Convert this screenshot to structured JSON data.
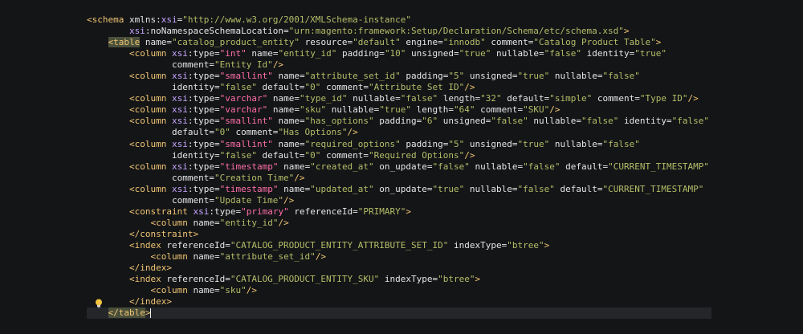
{
  "editor": {
    "lines": [
      {
        "indent": 0,
        "tokens": [
          [
            "tag",
            "<schema "
          ],
          [
            "attr",
            "xmlns:"
          ],
          [
            "ns",
            "xsi"
          ],
          [
            "punct",
            "="
          ],
          [
            "str",
            "\"http://www.w3.org/2001/XMLSchema-instance\""
          ]
        ]
      },
      {
        "indent": 8,
        "tokens": [
          [
            "ns",
            "xsi"
          ],
          [
            "attr",
            ":noNamespaceSchemaLocation="
          ],
          [
            "str",
            "\"urn:magento:framework:Setup/Declaration/Schema/etc/schema.xsd\""
          ],
          [
            "tag",
            ">"
          ]
        ]
      },
      {
        "indent": 4,
        "tokens": [
          [
            "taghl",
            "<table"
          ],
          [
            "attr",
            " name="
          ],
          [
            "str",
            "\"catalog_product_entity\""
          ],
          [
            "attr",
            " resource="
          ],
          [
            "str",
            "\"default\""
          ],
          [
            "attr",
            " engine="
          ],
          [
            "str",
            "\"innodb\""
          ],
          [
            "attr",
            " comment="
          ],
          [
            "str",
            "\"Catalog Product Table\""
          ],
          [
            "tag",
            ">"
          ]
        ]
      },
      {
        "indent": 8,
        "tokens": [
          [
            "tag",
            "<column "
          ],
          [
            "ns",
            "xsi"
          ],
          [
            "attr",
            ":type="
          ],
          [
            "type",
            "\"int\""
          ],
          [
            "attr",
            " name="
          ],
          [
            "str",
            "\"entity_id\""
          ],
          [
            "attr",
            " padding="
          ],
          [
            "str",
            "\"10\""
          ],
          [
            "attr",
            " unsigned="
          ],
          [
            "str",
            "\"true\""
          ],
          [
            "attr",
            " nullable="
          ],
          [
            "str",
            "\"false\""
          ],
          [
            "attr",
            " identity="
          ],
          [
            "str",
            "\"true\""
          ]
        ]
      },
      {
        "indent": 16,
        "tokens": [
          [
            "attr",
            "comment="
          ],
          [
            "str",
            "\"Entity Id\""
          ],
          [
            "tag",
            "/>"
          ]
        ]
      },
      {
        "indent": 8,
        "tokens": [
          [
            "tag",
            "<column "
          ],
          [
            "ns",
            "xsi"
          ],
          [
            "attr",
            ":type="
          ],
          [
            "type",
            "\"smallint\""
          ],
          [
            "attr",
            " name="
          ],
          [
            "str",
            "\"attribute_set_id\""
          ],
          [
            "attr",
            " padding="
          ],
          [
            "str",
            "\"5\""
          ],
          [
            "attr",
            " unsigned="
          ],
          [
            "str",
            "\"true\""
          ],
          [
            "attr",
            " nullable="
          ],
          [
            "str",
            "\"false\""
          ]
        ]
      },
      {
        "indent": 16,
        "tokens": [
          [
            "attr",
            "identity="
          ],
          [
            "str",
            "\"false\""
          ],
          [
            "attr",
            " default="
          ],
          [
            "str",
            "\"0\""
          ],
          [
            "attr",
            " comment="
          ],
          [
            "str",
            "\"Attribute Set ID\""
          ],
          [
            "tag",
            "/>"
          ]
        ]
      },
      {
        "indent": 8,
        "tokens": [
          [
            "tag",
            "<column "
          ],
          [
            "ns",
            "xsi"
          ],
          [
            "attr",
            ":type="
          ],
          [
            "type",
            "\"varchar\""
          ],
          [
            "attr",
            " name="
          ],
          [
            "str",
            "\"type_id\""
          ],
          [
            "attr",
            " nullable="
          ],
          [
            "str",
            "\"false\""
          ],
          [
            "attr",
            " length="
          ],
          [
            "str",
            "\"32\""
          ],
          [
            "attr",
            " default="
          ],
          [
            "str",
            "\"simple\""
          ],
          [
            "attr",
            " comment="
          ],
          [
            "str",
            "\"Type ID\""
          ],
          [
            "tag",
            "/>"
          ]
        ]
      },
      {
        "indent": 8,
        "tokens": [
          [
            "tag",
            "<column "
          ],
          [
            "ns",
            "xsi"
          ],
          [
            "attr",
            ":type="
          ],
          [
            "type",
            "\"varchar\""
          ],
          [
            "attr",
            " name="
          ],
          [
            "str",
            "\"sku\""
          ],
          [
            "attr",
            " nullable="
          ],
          [
            "str",
            "\"true\""
          ],
          [
            "attr",
            " length="
          ],
          [
            "str",
            "\"64\""
          ],
          [
            "attr",
            " comment="
          ],
          [
            "str",
            "\"SKU\""
          ],
          [
            "tag",
            "/>"
          ]
        ]
      },
      {
        "indent": 8,
        "tokens": [
          [
            "tag",
            "<column "
          ],
          [
            "ns",
            "xsi"
          ],
          [
            "attr",
            ":type="
          ],
          [
            "type",
            "\"smallint\""
          ],
          [
            "attr",
            " name="
          ],
          [
            "str",
            "\"has_options\""
          ],
          [
            "attr",
            " padding="
          ],
          [
            "str",
            "\"6\""
          ],
          [
            "attr",
            " unsigned="
          ],
          [
            "str",
            "\"false\""
          ],
          [
            "attr",
            " nullable="
          ],
          [
            "str",
            "\"false\""
          ],
          [
            "attr",
            " identity="
          ],
          [
            "str",
            "\"false\""
          ]
        ]
      },
      {
        "indent": 16,
        "tokens": [
          [
            "attr",
            "default="
          ],
          [
            "str",
            "\"0\""
          ],
          [
            "attr",
            " comment="
          ],
          [
            "str",
            "\"Has Options\""
          ],
          [
            "tag",
            "/>"
          ]
        ]
      },
      {
        "indent": 8,
        "tokens": [
          [
            "tag",
            "<column "
          ],
          [
            "ns",
            "xsi"
          ],
          [
            "attr",
            ":type="
          ],
          [
            "type",
            "\"smallint\""
          ],
          [
            "attr",
            " name="
          ],
          [
            "str",
            "\"required_options\""
          ],
          [
            "attr",
            " padding="
          ],
          [
            "str",
            "\"5\""
          ],
          [
            "attr",
            " unsigned="
          ],
          [
            "str",
            "\"true\""
          ],
          [
            "attr",
            " nullable="
          ],
          [
            "str",
            "\"false\""
          ]
        ]
      },
      {
        "indent": 16,
        "tokens": [
          [
            "attr",
            "identity="
          ],
          [
            "str",
            "\"false\""
          ],
          [
            "attr",
            " default="
          ],
          [
            "str",
            "\"0\""
          ],
          [
            "attr",
            " comment="
          ],
          [
            "str",
            "\"Required Options\""
          ],
          [
            "tag",
            "/>"
          ]
        ]
      },
      {
        "indent": 8,
        "tokens": [
          [
            "tag",
            "<column "
          ],
          [
            "ns",
            "xsi"
          ],
          [
            "attr",
            ":type="
          ],
          [
            "type",
            "\"timestamp\""
          ],
          [
            "attr",
            " name="
          ],
          [
            "str",
            "\"created_at\""
          ],
          [
            "attr",
            " on_update="
          ],
          [
            "str",
            "\"false\""
          ],
          [
            "attr",
            " nullable="
          ],
          [
            "str",
            "\"false\""
          ],
          [
            "attr",
            " default="
          ],
          [
            "str",
            "\"CURRENT_TIMESTAMP\""
          ]
        ]
      },
      {
        "indent": 16,
        "tokens": [
          [
            "attr",
            "comment="
          ],
          [
            "str",
            "\"Creation Time\""
          ],
          [
            "tag",
            "/>"
          ]
        ]
      },
      {
        "indent": 8,
        "tokens": [
          [
            "tag",
            "<column "
          ],
          [
            "ns",
            "xsi"
          ],
          [
            "attr",
            ":type="
          ],
          [
            "type",
            "\"timestamp\""
          ],
          [
            "attr",
            " name="
          ],
          [
            "str",
            "\"updated_at\""
          ],
          [
            "attr",
            " on_update="
          ],
          [
            "str",
            "\"true\""
          ],
          [
            "attr",
            " nullable="
          ],
          [
            "str",
            "\"false\""
          ],
          [
            "attr",
            " default="
          ],
          [
            "str",
            "\"CURRENT_TIMESTAMP\""
          ]
        ]
      },
      {
        "indent": 16,
        "tokens": [
          [
            "attr",
            "comment="
          ],
          [
            "str",
            "\"Update Time\""
          ],
          [
            "tag",
            "/>"
          ]
        ]
      },
      {
        "indent": 8,
        "tokens": [
          [
            "tag",
            "<constraint "
          ],
          [
            "ns",
            "xsi"
          ],
          [
            "attr",
            ":type="
          ],
          [
            "type",
            "\"primary\""
          ],
          [
            "attr",
            " referenceId="
          ],
          [
            "str",
            "\"PRIMARY\""
          ],
          [
            "tag",
            ">"
          ]
        ]
      },
      {
        "indent": 12,
        "tokens": [
          [
            "tag",
            "<column "
          ],
          [
            "attr",
            "name="
          ],
          [
            "str",
            "\"entity_id\""
          ],
          [
            "tag",
            "/>"
          ]
        ]
      },
      {
        "indent": 8,
        "tokens": [
          [
            "tag",
            "</constraint>"
          ]
        ]
      },
      {
        "indent": 8,
        "tokens": [
          [
            "tag",
            "<index "
          ],
          [
            "attr",
            "referenceId="
          ],
          [
            "str",
            "\"CATALOG_PRODUCT_ENTITY_ATTRIBUTE_SET_ID\""
          ],
          [
            "attr",
            " indexType="
          ],
          [
            "str",
            "\"btree\""
          ],
          [
            "tag",
            ">"
          ]
        ]
      },
      {
        "indent": 12,
        "tokens": [
          [
            "tag",
            "<column "
          ],
          [
            "attr",
            "name="
          ],
          [
            "str",
            "\"attribute_set_id\""
          ],
          [
            "tag",
            "/>"
          ]
        ]
      },
      {
        "indent": 8,
        "tokens": [
          [
            "tag",
            "</index>"
          ]
        ]
      },
      {
        "indent": 8,
        "tokens": [
          [
            "tag",
            "<index "
          ],
          [
            "attr",
            "referenceId="
          ],
          [
            "str",
            "\"CATALOG_PRODUCT_ENTITY_SKU\""
          ],
          [
            "attr",
            " indexType="
          ],
          [
            "str",
            "\"btree\""
          ],
          [
            "tag",
            ">"
          ]
        ]
      },
      {
        "indent": 12,
        "tokens": [
          [
            "tag",
            "<column "
          ],
          [
            "attr",
            "name="
          ],
          [
            "str",
            "\"sku\""
          ],
          [
            "tag",
            "/>"
          ]
        ]
      },
      {
        "indent": 8,
        "tokens": [
          [
            "tag",
            "</index>"
          ]
        ]
      },
      {
        "indent": 4,
        "tokens": [
          [
            "taghl",
            "</table"
          ],
          [
            "tag",
            ">"
          ]
        ],
        "current": true
      }
    ]
  },
  "colors": {
    "background": "#141517",
    "tag": "#f0c674",
    "string": "#b5bd68",
    "type": "#ff6fa8",
    "namespace": "#c5a5ff"
  },
  "icons": {
    "gutter_hint": "lightbulb-icon"
  }
}
